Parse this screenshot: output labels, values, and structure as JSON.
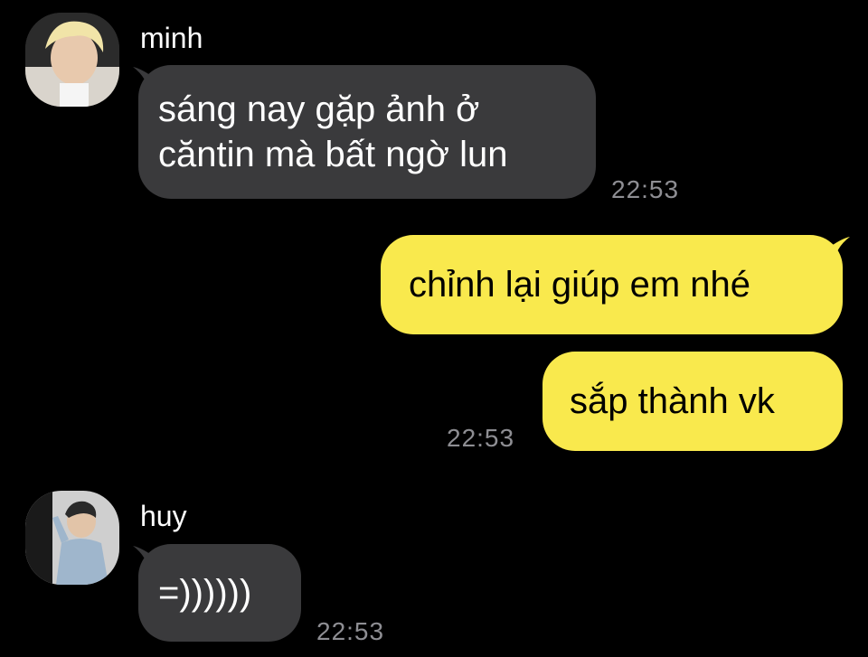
{
  "messages": [
    {
      "sender": "minh",
      "direction": "incoming",
      "lines": [
        "sáng nay gặp ảnh ở",
        "căntin mà bất ngờ lun"
      ],
      "time": "22:53"
    },
    {
      "direction": "outgoing",
      "bubbles": [
        "chỉnh lại giúp em nhé",
        "sắp thành vk"
      ],
      "time": "22:53"
    },
    {
      "sender": "huy",
      "direction": "incoming",
      "lines": [
        "=))))))"
      ],
      "time": "22:53"
    }
  ],
  "colors": {
    "background": "#000000",
    "incoming_bubble": "#3a3a3c",
    "outgoing_bubble": "#f9e94d",
    "timestamp": "#8e8e93"
  },
  "icons": {
    "avatar_minh": "profile-photo-icon",
    "avatar_huy": "profile-photo-icon"
  }
}
